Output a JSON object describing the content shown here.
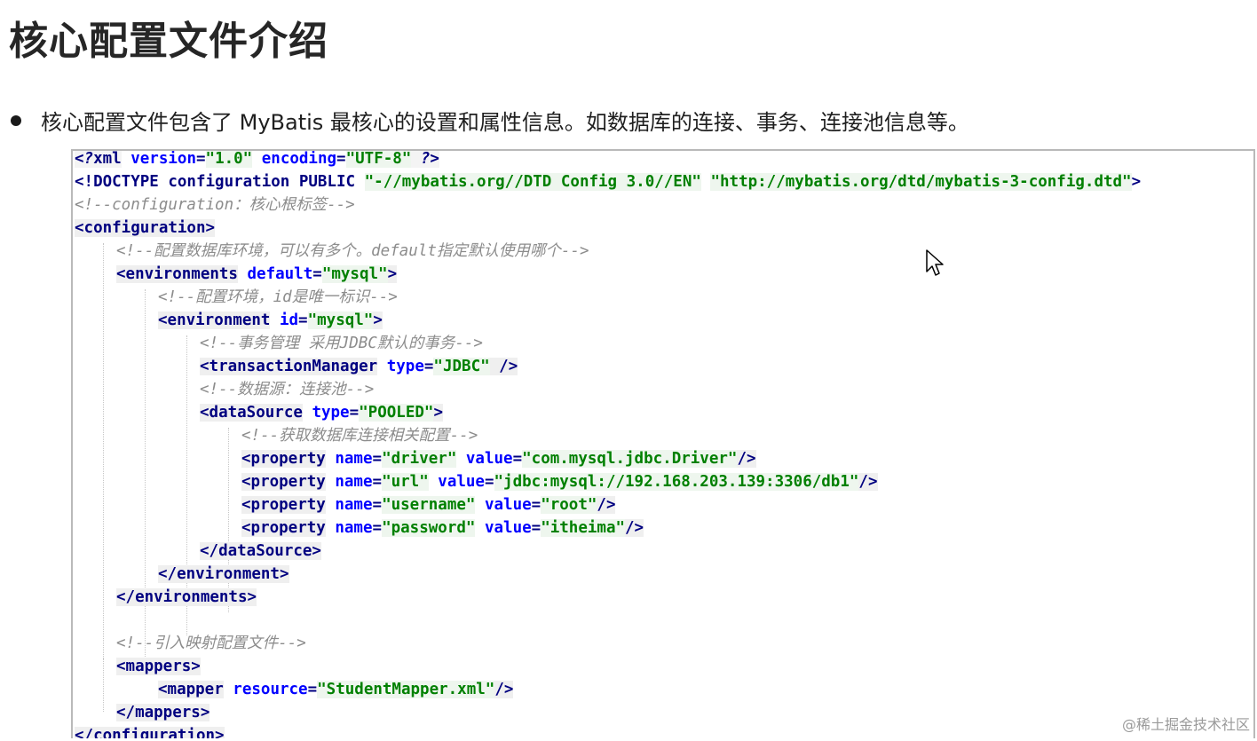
{
  "title": "核心配置文件介绍",
  "bullet": "核心配置文件包含了 MyBatis 最核心的设置和属性信息。如数据库的连接、事务、连接池信息等。",
  "watermark": "@稀土掘金技术社区",
  "code": {
    "l1": {
      "a": "<?",
      "b": "xml",
      "c": " version",
      "d": "=",
      "e": "\"1.0\"",
      "f": " encoding",
      "g": "=",
      "h": "\"UTF-8\"",
      "i": " ?>"
    },
    "l2": {
      "a": "<!DOCTYPE configuration PUBLIC ",
      "b": "\"-//mybatis.org//DTD Config 3.0//EN\"",
      "c": " ",
      "d": "\"http://mybatis.org/dtd/mybatis-3-config.dtd\"",
      "e": ">"
    },
    "l3": "<!--configuration：核心根标签-->",
    "l4": "<configuration>",
    "l5": "<!--配置数据库环境，可以有多个。default指定默认使用哪个-->",
    "l6": {
      "open": "<environments",
      "attr": " default",
      "eq": "=",
      "val": "\"mysql\"",
      "close": ">"
    },
    "l7": "<!--配置环境，id是唯一标识-->",
    "l8": {
      "open": "<environment",
      "attr": " id",
      "eq": "=",
      "val": "\"mysql\"",
      "close": ">"
    },
    "l9": "<!--事务管理 采用JDBC默认的事务-->",
    "l10": {
      "open": "<transactionManager",
      "attr": " type",
      "eq": "=",
      "val": "\"JDBC\"",
      "close": " />"
    },
    "l11": "<!--数据源：连接池-->",
    "l12": {
      "open": "<dataSource",
      "attr": " type",
      "eq": "=",
      "val": "\"POOLED\"",
      "close": ">"
    },
    "l13": "<!--获取数据库连接相关配置-->",
    "l14": {
      "open": "<property",
      "a1": " name",
      "eq1": "=",
      "v1": "\"driver\"",
      "a2": " value",
      "eq2": "=",
      "v2": "\"com.mysql.jdbc.Driver\"",
      "close": "/>"
    },
    "l15": {
      "open": "<property",
      "a1": " name",
      "eq1": "=",
      "v1": "\"url\"",
      "a2": " value",
      "eq2": "=",
      "v2": "\"jdbc:mysql://192.168.203.139:3306/db1\"",
      "close": "/>"
    },
    "l16": {
      "open": "<property",
      "a1": " name",
      "eq1": "=",
      "v1": "\"username\"",
      "a2": " value",
      "eq2": "=",
      "v2": "\"root\"",
      "close": "/>"
    },
    "l17": {
      "open": "<property",
      "a1": " name",
      "eq1": "=",
      "v1": "\"password\"",
      "a2": " value",
      "eq2": "=",
      "v2": "\"itheima\"",
      "close": "/>"
    },
    "l18": "</dataSource>",
    "l19": "</environment>",
    "l20": "</environments>",
    "l22": "<!--引入映射配置文件-->",
    "l23": "<mappers>",
    "l24": {
      "open": "<mapper",
      "attr": " resource",
      "eq": "=",
      "val": "\"StudentMapper.xml\"",
      "close": "/>"
    },
    "l25": "</mappers>",
    "l26": "</configuration>"
  }
}
